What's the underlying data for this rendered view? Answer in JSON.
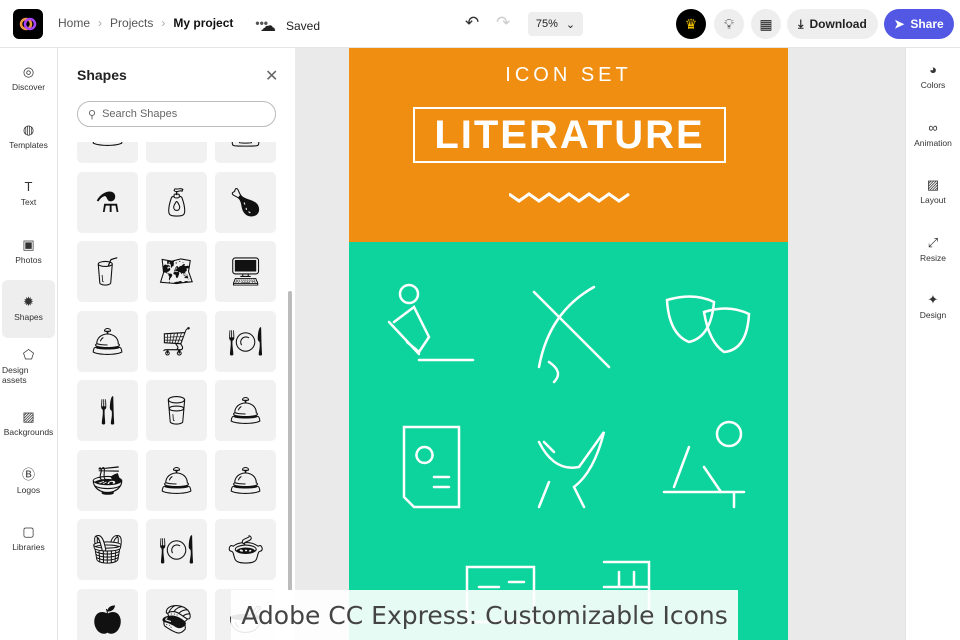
{
  "header": {
    "breadcrumbs": [
      "Home",
      "Projects",
      "My project"
    ],
    "more": "•••",
    "status": "Saved",
    "zoom": "75%",
    "download": "Download",
    "share": "Share"
  },
  "left_rail": [
    {
      "label": "Discover",
      "icon": "◎"
    },
    {
      "label": "Templates",
      "icon": "◍"
    },
    {
      "label": "Text",
      "icon": "T"
    },
    {
      "label": "Photos",
      "icon": "▣"
    },
    {
      "label": "Shapes",
      "icon": "✹"
    },
    {
      "label": "Design assets",
      "icon": "⬠"
    },
    {
      "label": "Backgrounds",
      "icon": "▨"
    },
    {
      "label": "Logos",
      "icon": "Ⓑ"
    },
    {
      "label": "Libraries",
      "icon": "▢"
    }
  ],
  "right_rail": [
    {
      "label": "Colors",
      "icon": "◕"
    },
    {
      "label": "Animation",
      "icon": "∞"
    },
    {
      "label": "Layout",
      "icon": "▨"
    },
    {
      "label": "Resize",
      "icon": "⤢"
    },
    {
      "label": "Design",
      "icon": "✦"
    }
  ],
  "panel": {
    "title": "Shapes",
    "search_placeholder": "Search Shapes"
  },
  "canvas": {
    "subtitle": "ICON SET",
    "title": "LITERATURE"
  },
  "caption": "Adobe CC Express: Customizable Icons",
  "colors": {
    "orange": "#ef8e10",
    "teal": "#0dd39c",
    "accent": "#5258e4"
  }
}
